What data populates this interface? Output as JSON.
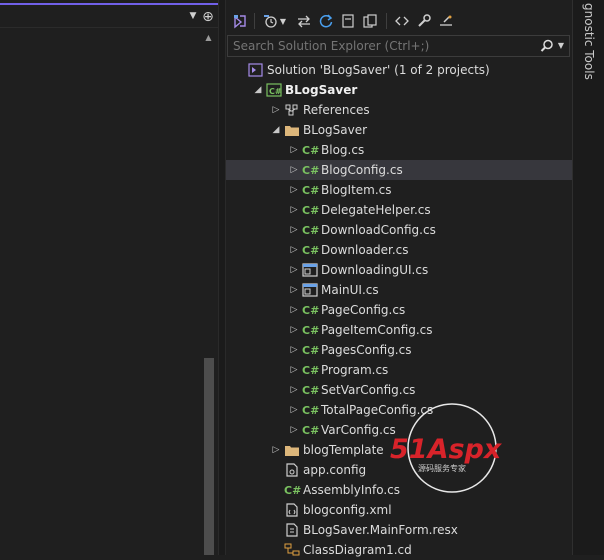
{
  "toolbar": {
    "buttons": [
      "vs-icon",
      "history-icon",
      "dropdown-arrow-icon",
      "sync-icon",
      "refresh-icon",
      "collapse-icon",
      "copy-icon",
      "code-icon",
      "wrench-icon",
      "properties-icon"
    ]
  },
  "search": {
    "placeholder": "Search Solution Explorer (Ctrl+;)"
  },
  "diagnostic": {
    "label": "gnostic Tools"
  },
  "tree": [
    {
      "label": "Solution 'BLogSaver' (1 of 2 projects)",
      "icon": "solution",
      "indent": 0,
      "expander": "",
      "bold": false
    },
    {
      "label": "BLogSaver",
      "icon": "csproj",
      "indent": 1,
      "expander": "expanded",
      "bold": true
    },
    {
      "label": "References",
      "icon": "references",
      "indent": 2,
      "expander": "collapsed",
      "bold": false
    },
    {
      "label": "BLogSaver",
      "icon": "folder",
      "indent": 2,
      "expander": "expanded",
      "bold": false
    },
    {
      "label": "Blog.cs",
      "icon": "cs",
      "indent": 3,
      "expander": "collapsed",
      "bold": false
    },
    {
      "label": "BlogConfig.cs",
      "icon": "cs",
      "indent": 3,
      "expander": "collapsed",
      "bold": false,
      "selected": true
    },
    {
      "label": "BlogItem.cs",
      "icon": "cs",
      "indent": 3,
      "expander": "collapsed",
      "bold": false
    },
    {
      "label": "DelegateHelper.cs",
      "icon": "cs",
      "indent": 3,
      "expander": "collapsed",
      "bold": false
    },
    {
      "label": "DownloadConfig.cs",
      "icon": "cs",
      "indent": 3,
      "expander": "collapsed",
      "bold": false
    },
    {
      "label": "Downloader.cs",
      "icon": "cs",
      "indent": 3,
      "expander": "collapsed",
      "bold": false
    },
    {
      "label": "DownloadingUI.cs",
      "icon": "form",
      "indent": 3,
      "expander": "collapsed",
      "bold": false
    },
    {
      "label": "MainUI.cs",
      "icon": "form",
      "indent": 3,
      "expander": "collapsed",
      "bold": false
    },
    {
      "label": "PageConfig.cs",
      "icon": "cs",
      "indent": 3,
      "expander": "collapsed",
      "bold": false
    },
    {
      "label": "PageItemConfig.cs",
      "icon": "cs",
      "indent": 3,
      "expander": "collapsed",
      "bold": false
    },
    {
      "label": "PagesConfig.cs",
      "icon": "cs",
      "indent": 3,
      "expander": "collapsed",
      "bold": false
    },
    {
      "label": "Program.cs",
      "icon": "cs",
      "indent": 3,
      "expander": "collapsed",
      "bold": false
    },
    {
      "label": "SetVarConfig.cs",
      "icon": "cs",
      "indent": 3,
      "expander": "collapsed",
      "bold": false
    },
    {
      "label": "TotalPageConfig.cs",
      "icon": "cs",
      "indent": 3,
      "expander": "collapsed",
      "bold": false
    },
    {
      "label": "VarConfig.cs",
      "icon": "cs",
      "indent": 3,
      "expander": "collapsed",
      "bold": false
    },
    {
      "label": "blogTemplate",
      "icon": "folder",
      "indent": 2,
      "expander": "collapsed",
      "bold": false
    },
    {
      "label": "app.config",
      "icon": "config",
      "indent": 2,
      "expander": "",
      "bold": false
    },
    {
      "label": "AssemblyInfo.cs",
      "icon": "cs",
      "indent": 2,
      "expander": "",
      "bold": false
    },
    {
      "label": "blogconfig.xml",
      "icon": "xml",
      "indent": 2,
      "expander": "",
      "bold": false
    },
    {
      "label": "BLogSaver.MainForm.resx",
      "icon": "resx",
      "indent": 2,
      "expander": "",
      "bold": false
    },
    {
      "label": "ClassDiagram1.cd",
      "icon": "diagram",
      "indent": 2,
      "expander": "",
      "bold": false
    }
  ],
  "watermark": {
    "logo": "51Aspx",
    "tagline": "源码服务专家"
  },
  "colors": {
    "accent": "#7160e8",
    "cs_green": "#7ac160",
    "folder": "#dcb67a",
    "selection": "#37373d",
    "watermark_red": "#d8232a",
    "watermark_green": "#4c9a2a"
  }
}
